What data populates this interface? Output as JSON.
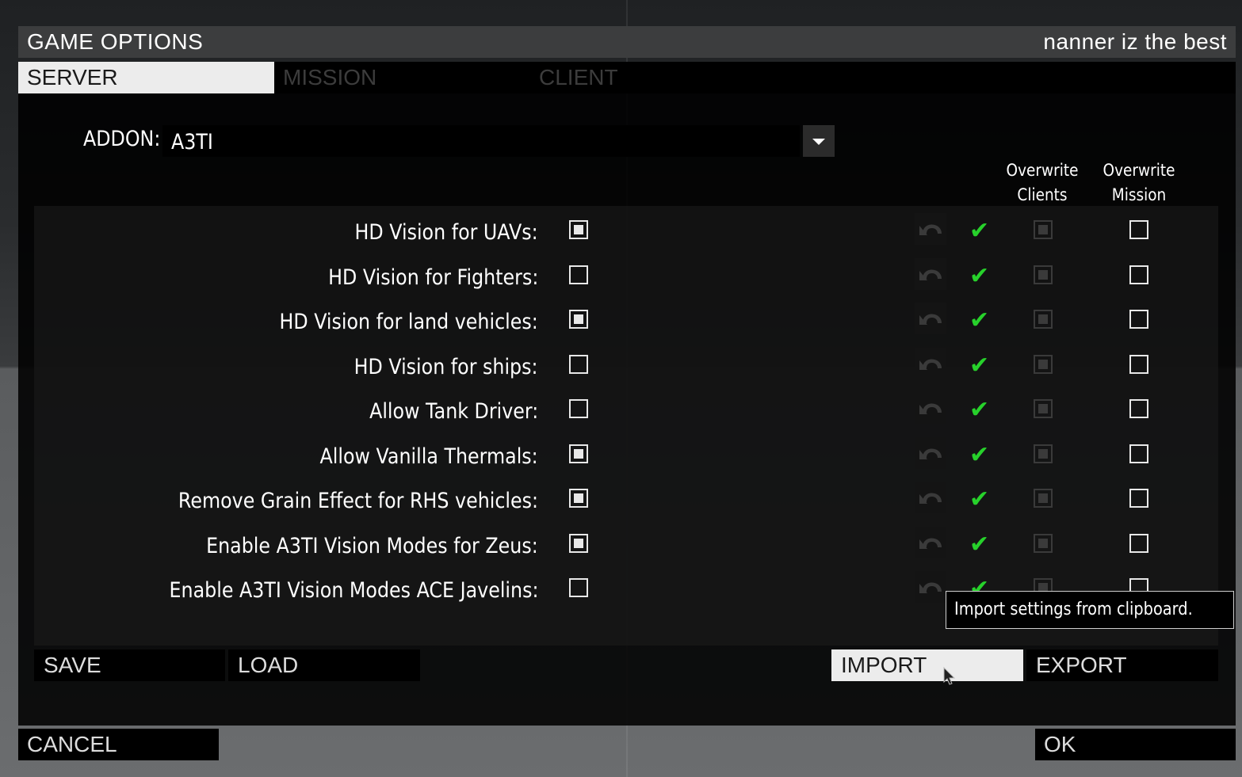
{
  "title": "GAME OPTIONS",
  "user_name": "nanner iz the best",
  "tabs": [
    {
      "label": "SERVER",
      "active": true
    },
    {
      "label": "MISSION",
      "active": false
    },
    {
      "label": "CLIENT",
      "active": false
    }
  ],
  "addon": {
    "label": "ADDON:",
    "value": "A3TI"
  },
  "columns": {
    "overwrite_clients": [
      "Overwrite",
      "Clients"
    ],
    "overwrite_mission": [
      "Overwrite",
      "Mission"
    ]
  },
  "settings": [
    {
      "label": "HD Vision for UAVs:",
      "value": true,
      "overwrite_clients": true,
      "overwrite_mission": false
    },
    {
      "label": "HD Vision for Fighters:",
      "value": false,
      "overwrite_clients": true,
      "overwrite_mission": false
    },
    {
      "label": "HD Vision for land vehicles:",
      "value": true,
      "overwrite_clients": true,
      "overwrite_mission": false
    },
    {
      "label": "HD Vision for ships:",
      "value": false,
      "overwrite_clients": true,
      "overwrite_mission": false
    },
    {
      "label": "Allow Tank Driver:",
      "value": false,
      "overwrite_clients": true,
      "overwrite_mission": false
    },
    {
      "label": "Allow Vanilla Thermals:",
      "value": true,
      "overwrite_clients": true,
      "overwrite_mission": false
    },
    {
      "label": "Remove Grain Effect for RHS vehicles:",
      "value": true,
      "overwrite_clients": true,
      "overwrite_mission": false
    },
    {
      "label": "Enable A3TI Vision Modes for Zeus:",
      "value": true,
      "overwrite_clients": true,
      "overwrite_mission": false
    },
    {
      "label": "Enable A3TI Vision Modes ACE Javelins:",
      "value": false,
      "overwrite_clients": true,
      "overwrite_mission": false
    }
  ],
  "buttons": {
    "save": "SAVE",
    "load": "LOAD",
    "import": "IMPORT",
    "export": "EXPORT",
    "cancel": "CANCEL",
    "ok": "OK"
  },
  "tooltip": "Import settings from clipboard.",
  "icons": {
    "reset": "reset-icon",
    "applied": "checkmark-icon",
    "dropdown": "chevron-down-icon",
    "cursor": "mouse-cursor-icon"
  },
  "colors": {
    "accent_check": "#27d12b",
    "tab_active_bg": "#ececec"
  }
}
